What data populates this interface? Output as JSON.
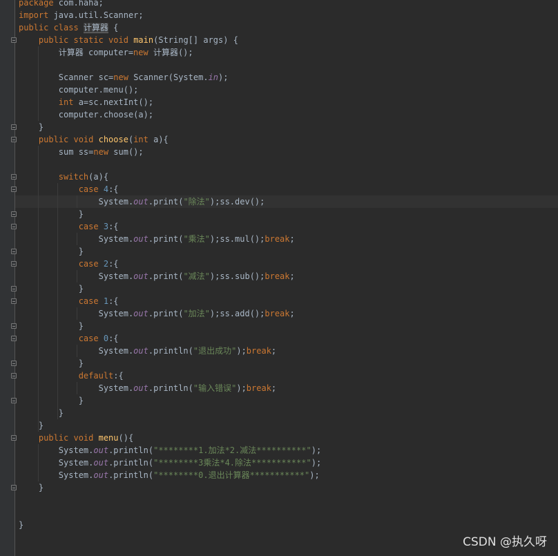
{
  "editor": {
    "lines": [
      {
        "tokens": [
          [
            "kw",
            "package "
          ],
          [
            "t",
            "com.haha;"
          ]
        ]
      },
      {
        "tokens": [
          [
            "kw",
            "import "
          ],
          [
            "t",
            "java.util.Scanner;"
          ]
        ]
      },
      {
        "tokens": [
          [
            "kw",
            "public class "
          ],
          [
            "hl",
            "计算器"
          ],
          [
            "t",
            " {"
          ]
        ]
      },
      {
        "tokens": [
          [
            "t",
            "    "
          ],
          [
            "kw",
            "public static void "
          ],
          [
            "fn",
            "main"
          ],
          [
            "t",
            "(String[] args) {"
          ]
        ]
      },
      {
        "tokens": [
          [
            "t",
            "        计算器 computer="
          ],
          [
            "kw",
            "new "
          ],
          [
            "t",
            "计算器();"
          ]
        ]
      },
      {
        "tokens": []
      },
      {
        "tokens": [
          [
            "t",
            "        Scanner sc="
          ],
          [
            "kw",
            "new "
          ],
          [
            "t",
            "Scanner(System."
          ],
          [
            "st",
            "in"
          ],
          [
            "t",
            ");"
          ]
        ]
      },
      {
        "tokens": [
          [
            "t",
            "        computer.menu();"
          ]
        ]
      },
      {
        "tokens": [
          [
            "t",
            "        "
          ],
          [
            "kw",
            "int "
          ],
          [
            "t",
            "a=sc.nextInt();"
          ]
        ]
      },
      {
        "tokens": [
          [
            "t",
            "        computer.choose(a);"
          ]
        ]
      },
      {
        "tokens": [
          [
            "t",
            "    }"
          ]
        ]
      },
      {
        "tokens": [
          [
            "t",
            "    "
          ],
          [
            "kw",
            "public void "
          ],
          [
            "fn",
            "choose"
          ],
          [
            "t",
            "("
          ],
          [
            "kw",
            "int "
          ],
          [
            "t",
            "a){"
          ]
        ]
      },
      {
        "tokens": [
          [
            "t",
            "        sum ss="
          ],
          [
            "kw",
            "new "
          ],
          [
            "t",
            "sum();"
          ]
        ]
      },
      {
        "tokens": []
      },
      {
        "tokens": [
          [
            "t",
            "        "
          ],
          [
            "kw",
            "switch"
          ],
          [
            "t",
            "(a){"
          ]
        ]
      },
      {
        "tokens": [
          [
            "t",
            "            "
          ],
          [
            "kw",
            "case "
          ],
          [
            "num",
            "4"
          ],
          [
            "t",
            ":{"
          ]
        ]
      },
      {
        "tokens": [
          [
            "t",
            "                System."
          ],
          [
            "st",
            "out"
          ],
          [
            "t",
            ".print("
          ],
          [
            "str",
            "\"除法\""
          ],
          [
            "t",
            ");ss.dev();"
          ]
        ],
        "highlight": true
      },
      {
        "tokens": [
          [
            "t",
            "            }"
          ]
        ]
      },
      {
        "tokens": [
          [
            "t",
            "            "
          ],
          [
            "kw",
            "case "
          ],
          [
            "num",
            "3"
          ],
          [
            "t",
            ":{"
          ]
        ]
      },
      {
        "tokens": [
          [
            "t",
            "                System."
          ],
          [
            "st",
            "out"
          ],
          [
            "t",
            ".print("
          ],
          [
            "str",
            "\"乘法\""
          ],
          [
            "t",
            ");ss.mul();"
          ],
          [
            "kw",
            "break"
          ],
          [
            "t",
            ";"
          ]
        ]
      },
      {
        "tokens": [
          [
            "t",
            "            }"
          ]
        ]
      },
      {
        "tokens": [
          [
            "t",
            "            "
          ],
          [
            "kw",
            "case "
          ],
          [
            "num",
            "2"
          ],
          [
            "t",
            ":{"
          ]
        ]
      },
      {
        "tokens": [
          [
            "t",
            "                System."
          ],
          [
            "st",
            "out"
          ],
          [
            "t",
            ".print("
          ],
          [
            "str",
            "\"减法\""
          ],
          [
            "t",
            ");ss.sub();"
          ],
          [
            "kw",
            "break"
          ],
          [
            "t",
            ";"
          ]
        ]
      },
      {
        "tokens": [
          [
            "t",
            "            }"
          ]
        ]
      },
      {
        "tokens": [
          [
            "t",
            "            "
          ],
          [
            "kw",
            "case "
          ],
          [
            "num",
            "1"
          ],
          [
            "t",
            ":{"
          ]
        ]
      },
      {
        "tokens": [
          [
            "t",
            "                System."
          ],
          [
            "st",
            "out"
          ],
          [
            "t",
            ".print("
          ],
          [
            "str",
            "\"加法\""
          ],
          [
            "t",
            ");ss.add();"
          ],
          [
            "kw",
            "break"
          ],
          [
            "t",
            ";"
          ]
        ]
      },
      {
        "tokens": [
          [
            "t",
            "            }"
          ]
        ]
      },
      {
        "tokens": [
          [
            "t",
            "            "
          ],
          [
            "kw",
            "case "
          ],
          [
            "num",
            "0"
          ],
          [
            "t",
            ":{"
          ]
        ]
      },
      {
        "tokens": [
          [
            "t",
            "                System."
          ],
          [
            "st",
            "out"
          ],
          [
            "t",
            ".println("
          ],
          [
            "str",
            "\"退出成功\""
          ],
          [
            "t",
            ");"
          ],
          [
            "kw",
            "break"
          ],
          [
            "t",
            ";"
          ]
        ]
      },
      {
        "tokens": [
          [
            "t",
            "            }"
          ]
        ]
      },
      {
        "tokens": [
          [
            "t",
            "            "
          ],
          [
            "kw",
            "default"
          ],
          [
            "t",
            ":{"
          ]
        ]
      },
      {
        "tokens": [
          [
            "t",
            "                System."
          ],
          [
            "st",
            "out"
          ],
          [
            "t",
            ".println("
          ],
          [
            "str",
            "\"输入错误\""
          ],
          [
            "t",
            ");"
          ],
          [
            "kw",
            "break"
          ],
          [
            "t",
            ";"
          ]
        ]
      },
      {
        "tokens": [
          [
            "t",
            "            }"
          ]
        ]
      },
      {
        "tokens": [
          [
            "t",
            "        }"
          ]
        ]
      },
      {
        "tokens": [
          [
            "t",
            "    }"
          ]
        ]
      },
      {
        "tokens": [
          [
            "t",
            "    "
          ],
          [
            "kw",
            "public void "
          ],
          [
            "fn",
            "menu"
          ],
          [
            "t",
            "(){"
          ]
        ]
      },
      {
        "tokens": [
          [
            "t",
            "        System."
          ],
          [
            "st",
            "out"
          ],
          [
            "t",
            ".println("
          ],
          [
            "str",
            "\"********1.加法*2.减法**********\""
          ],
          [
            "t",
            ");"
          ]
        ]
      },
      {
        "tokens": [
          [
            "t",
            "        System."
          ],
          [
            "st",
            "out"
          ],
          [
            "t",
            ".println("
          ],
          [
            "str",
            "\"********3乘法*4.除法***********\""
          ],
          [
            "t",
            ");"
          ]
        ]
      },
      {
        "tokens": [
          [
            "t",
            "        System."
          ],
          [
            "st",
            "out"
          ],
          [
            "t",
            ".println("
          ],
          [
            "str",
            "\"********0.退出计算器***********\""
          ],
          [
            "t",
            ");"
          ]
        ]
      },
      {
        "tokens": [
          [
            "t",
            "    }"
          ]
        ]
      },
      {
        "tokens": []
      },
      {
        "tokens": []
      },
      {
        "tokens": [
          [
            "t",
            "}"
          ]
        ]
      }
    ],
    "fold_markers": [
      3,
      10,
      11,
      14,
      15,
      17,
      18,
      20,
      21,
      23,
      24,
      26,
      27,
      29,
      30,
      32,
      35,
      39
    ]
  },
  "watermark": "CSDN @执久呀",
  "colors": {
    "background": "#2b2b2b",
    "keyword": "#cc7832",
    "function": "#ffc66d",
    "string": "#6a8759",
    "number": "#6897bb",
    "static_field": "#9876aa",
    "text": "#a9b7c6"
  }
}
